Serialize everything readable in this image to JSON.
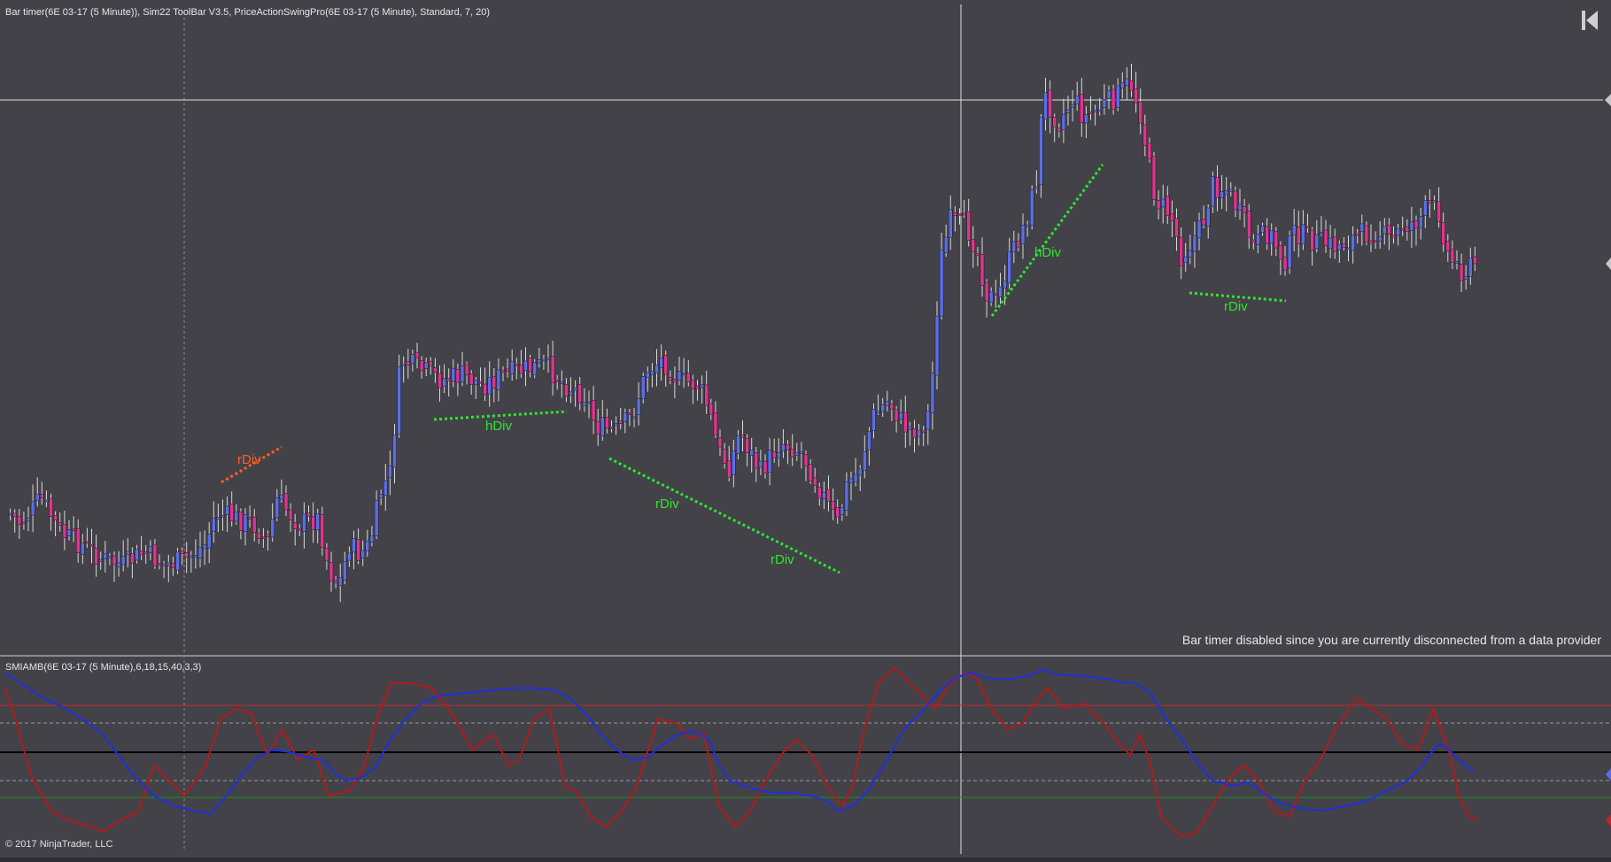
{
  "header": {
    "indicators_label": "Bar timer(6E 03-17 (5 Minute)), Sim22 ToolBar V3.5, PriceActionSwingPro(6E 03-17 (5 Minute), Standard, 7, 20)",
    "status_message": "Bar timer disabled since you are currently disconnected from a data provider",
    "copyright": "© 2017 NinjaTrader, LLC"
  },
  "icons": {
    "skip_to_end": "skip-to-end-icon"
  },
  "colors": {
    "background": "#434249",
    "up_candle": "#5b6ee8",
    "down_candle": "#e2338f",
    "wick": "#d9d9d9",
    "divergence_green": "#2ee62e",
    "divergence_orange": "#ff5f1f",
    "smi_red": "#b21a1a",
    "smi_blue": "#1f2fe0",
    "overbought_line": "#c0282a",
    "oversold_line": "#1f8f1f",
    "zero_line": "#000000"
  },
  "chart_data": [
    {
      "type": "candlestick",
      "panel": "price",
      "instrument": "6E 03-17 (5 Minute)",
      "bars_anchor": [
        [
          0,
          490
        ],
        [
          20,
          510
        ],
        [
          40,
          485
        ],
        [
          60,
          520
        ],
        [
          80,
          530
        ],
        [
          100,
          545
        ],
        [
          120,
          550
        ],
        [
          140,
          538
        ],
        [
          160,
          550
        ],
        [
          180,
          545
        ],
        [
          200,
          530
        ],
        [
          210,
          500
        ],
        [
          230,
          505
        ],
        [
          250,
          512
        ],
        [
          260,
          530
        ],
        [
          270,
          485
        ],
        [
          290,
          510
        ],
        [
          310,
          505
        ],
        [
          320,
          555
        ],
        [
          330,
          570
        ],
        [
          340,
          530
        ],
        [
          350,
          540
        ],
        [
          360,
          530
        ],
        [
          370,
          480
        ],
        [
          380,
          460
        ],
        [
          390,
          350
        ],
        [
          410,
          360
        ],
        [
          430,
          370
        ],
        [
          450,
          365
        ],
        [
          470,
          375
        ],
        [
          490,
          365
        ],
        [
          510,
          360
        ],
        [
          530,
          355
        ],
        [
          550,
          375
        ],
        [
          570,
          385
        ],
        [
          580,
          415
        ],
        [
          600,
          420
        ],
        [
          615,
          405
        ],
        [
          630,
          360
        ],
        [
          645,
          350
        ],
        [
          660,
          370
        ],
        [
          680,
          375
        ],
        [
          690,
          400
        ],
        [
          700,
          440
        ],
        [
          710,
          455
        ],
        [
          720,
          420
        ],
        [
          740,
          460
        ],
        [
          760,
          430
        ],
        [
          780,
          440
        ],
        [
          800,
          480
        ],
        [
          815,
          510
        ],
        [
          825,
          470
        ],
        [
          835,
          460
        ],
        [
          850,
          405
        ],
        [
          865,
          390
        ],
        [
          880,
          415
        ],
        [
          895,
          420
        ],
        [
          905,
          400
        ],
        [
          910,
          330
        ],
        [
          915,
          255
        ],
        [
          925,
          215
        ],
        [
          940,
          220
        ],
        [
          950,
          240
        ],
        [
          960,
          285
        ],
        [
          970,
          295
        ],
        [
          980,
          260
        ],
        [
          990,
          235
        ],
        [
          1000,
          210
        ],
        [
          1010,
          170
        ],
        [
          1015,
          90
        ],
        [
          1030,
          120
        ],
        [
          1045,
          95
        ],
        [
          1055,
          115
        ],
        [
          1070,
          105
        ],
        [
          1085,
          95
        ],
        [
          1100,
          80
        ],
        [
          1110,
          110
        ],
        [
          1118,
          160
        ],
        [
          1125,
          195
        ],
        [
          1140,
          210
        ],
        [
          1150,
          250
        ],
        [
          1160,
          235
        ],
        [
          1170,
          220
        ],
        [
          1180,
          180
        ],
        [
          1195,
          185
        ],
        [
          1210,
          215
        ],
        [
          1220,
          240
        ],
        [
          1235,
          225
        ],
        [
          1250,
          255
        ],
        [
          1260,
          225
        ],
        [
          1280,
          235
        ],
        [
          1300,
          240
        ],
        [
          1320,
          230
        ],
        [
          1340,
          225
        ],
        [
          1355,
          235
        ],
        [
          1365,
          220
        ],
        [
          1380,
          215
        ],
        [
          1390,
          200
        ],
        [
          1400,
          205
        ],
        [
          1410,
          250
        ],
        [
          1425,
          265
        ],
        [
          1437,
          255
        ]
      ],
      "divergence_annotations": [
        {
          "label": "rDiv",
          "color": "orange"
        },
        {
          "label": "hDiv",
          "color": "green"
        },
        {
          "label": "rDiv",
          "color": "green"
        },
        {
          "label": "rDiv",
          "color": "green"
        },
        {
          "label": "hDiv",
          "color": "green"
        },
        {
          "label": "rDiv",
          "color": "green"
        }
      ]
    },
    {
      "type": "line",
      "panel": "oscillator",
      "title": "SMIAMB(6E 03-17 (5 Minute),6,18,15,40,3,3)",
      "series": [
        {
          "color": "red",
          "points": [
            [
              5,
              670
            ],
            [
              15,
              700
            ],
            [
              30,
              755
            ],
            [
              50,
              790
            ],
            [
              70,
              800
            ],
            [
              90,
              805
            ],
            [
              100,
              810
            ],
            [
              115,
              800
            ],
            [
              135,
              790
            ],
            [
              150,
              745
            ],
            [
              165,
              760
            ],
            [
              180,
              775
            ],
            [
              200,
              745
            ],
            [
              215,
              700
            ],
            [
              230,
              690
            ],
            [
              245,
              695
            ],
            [
              260,
              735
            ],
            [
              275,
              710
            ],
            [
              290,
              740
            ],
            [
              305,
              730
            ],
            [
              320,
              775
            ],
            [
              340,
              770
            ],
            [
              355,
              745
            ],
            [
              365,
              705
            ],
            [
              380,
              665
            ],
            [
              400,
              665
            ],
            [
              420,
              670
            ],
            [
              440,
              695
            ],
            [
              460,
              730
            ],
            [
              480,
              715
            ],
            [
              495,
              745
            ],
            [
              505,
              740
            ],
            [
              520,
              700
            ],
            [
              535,
              690
            ],
            [
              550,
              765
            ],
            [
              560,
              770
            ],
            [
              575,
              795
            ],
            [
              590,
              805
            ],
            [
              605,
              790
            ],
            [
              620,
              765
            ],
            [
              640,
              700
            ],
            [
              660,
              705
            ],
            [
              670,
              720
            ],
            [
              685,
              715
            ],
            [
              700,
              785
            ],
            [
              715,
              805
            ],
            [
              730,
              790
            ],
            [
              745,
              760
            ],
            [
              760,
              735
            ],
            [
              775,
              720
            ],
            [
              790,
              735
            ],
            [
              805,
              765
            ],
            [
              820,
              785
            ],
            [
              830,
              765
            ],
            [
              840,
              715
            ],
            [
              855,
              665
            ],
            [
              870,
              650
            ],
            [
              885,
              665
            ],
            [
              900,
              680
            ],
            [
              910,
              690
            ],
            [
              925,
              665
            ],
            [
              940,
              655
            ],
            [
              950,
              660
            ],
            [
              965,
              690
            ],
            [
              980,
              710
            ],
            [
              995,
              705
            ],
            [
              1010,
              680
            ],
            [
              1020,
              670
            ],
            [
              1035,
              690
            ],
            [
              1055,
              685
            ],
            [
              1075,
              705
            ],
            [
              1090,
              725
            ],
            [
              1100,
              735
            ],
            [
              1110,
              715
            ],
            [
              1120,
              745
            ],
            [
              1130,
              795
            ],
            [
              1150,
              815
            ],
            [
              1165,
              810
            ],
            [
              1180,
              785
            ],
            [
              1195,
              760
            ],
            [
              1210,
              745
            ],
            [
              1225,
              760
            ],
            [
              1240,
              790
            ],
            [
              1255,
              795
            ],
            [
              1270,
              760
            ],
            [
              1285,
              740
            ],
            [
              1300,
              710
            ],
            [
              1320,
              680
            ],
            [
              1335,
              690
            ],
            [
              1350,
              700
            ],
            [
              1365,
              725
            ],
            [
              1380,
              730
            ],
            [
              1395,
              690
            ],
            [
              1410,
              730
            ],
            [
              1420,
              775
            ],
            [
              1430,
              795
            ],
            [
              1438,
              798
            ]
          ]
        },
        {
          "color": "blue",
          "points": [
            [
              5,
              655
            ],
            [
              20,
              665
            ],
            [
              40,
              678
            ],
            [
              60,
              688
            ],
            [
              80,
              700
            ],
            [
              100,
              715
            ],
            [
              115,
              735
            ],
            [
              130,
              755
            ],
            [
              150,
              775
            ],
            [
              170,
              785
            ],
            [
              190,
              790
            ],
            [
              205,
              792
            ],
            [
              220,
              775
            ],
            [
              235,
              755
            ],
            [
              250,
              738
            ],
            [
              265,
              730
            ],
            [
              280,
              732
            ],
            [
              300,
              738
            ],
            [
              315,
              740
            ],
            [
              325,
              752
            ],
            [
              335,
              760
            ],
            [
              350,
              758
            ],
            [
              365,
              748
            ],
            [
              380,
              720
            ],
            [
              395,
              700
            ],
            [
              410,
              685
            ],
            [
              425,
              678
            ],
            [
              440,
              676
            ],
            [
              460,
              674
            ],
            [
              480,
              672
            ],
            [
              500,
              670
            ],
            [
              520,
              670
            ],
            [
              540,
              672
            ],
            [
              555,
              680
            ],
            [
              570,
              695
            ],
            [
              585,
              715
            ],
            [
              600,
              730
            ],
            [
              615,
              740
            ],
            [
              630,
              738
            ],
            [
              645,
              725
            ],
            [
              660,
              715
            ],
            [
              675,
              712
            ],
            [
              690,
              720
            ],
            [
              700,
              745
            ],
            [
              710,
              760
            ],
            [
              725,
              765
            ],
            [
              740,
              770
            ],
            [
              755,
              772
            ],
            [
              770,
              772
            ],
            [
              790,
              775
            ],
            [
              805,
              780
            ],
            [
              815,
              790
            ],
            [
              830,
              785
            ],
            [
              845,
              770
            ],
            [
              860,
              745
            ],
            [
              880,
              710
            ],
            [
              900,
              690
            ],
            [
              915,
              672
            ],
            [
              930,
              660
            ],
            [
              945,
              655
            ],
            [
              960,
              660
            ],
            [
              980,
              662
            ],
            [
              1000,
              658
            ],
            [
              1015,
              652
            ],
            [
              1030,
              657
            ],
            [
              1050,
              658
            ],
            [
              1070,
              660
            ],
            [
              1090,
              664
            ],
            [
              1105,
              665
            ],
            [
              1120,
              675
            ],
            [
              1135,
              700
            ],
            [
              1150,
              720
            ],
            [
              1165,
              742
            ],
            [
              1180,
              760
            ],
            [
              1200,
              765
            ],
            [
              1215,
              762
            ],
            [
              1235,
              776
            ],
            [
              1250,
              783
            ],
            [
              1270,
              788
            ],
            [
              1290,
              789
            ],
            [
              1310,
              785
            ],
            [
              1330,
              780
            ],
            [
              1350,
              770
            ],
            [
              1370,
              760
            ],
            [
              1385,
              745
            ],
            [
              1398,
              726
            ],
            [
              1405,
              725
            ],
            [
              1420,
              740
            ],
            [
              1435,
              752
            ]
          ]
        }
      ],
      "reference_lines": [
        "overbought",
        "upper-dashed",
        "zero",
        "lower-dashed",
        "oversold"
      ]
    }
  ]
}
